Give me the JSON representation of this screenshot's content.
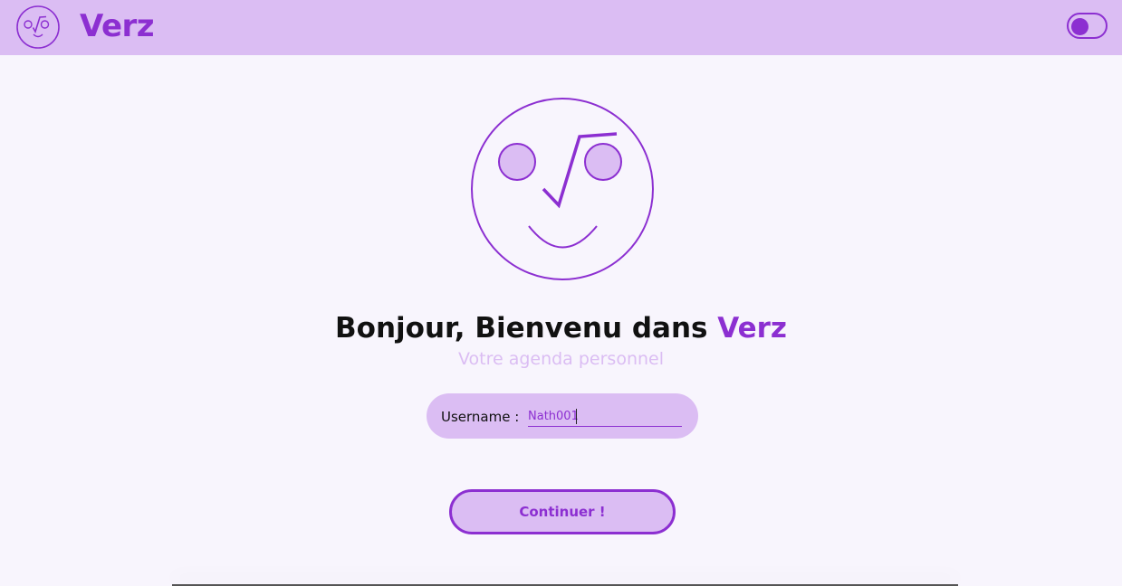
{
  "header": {
    "brand": "Verz",
    "logo_icon": "smiley-sqrt-icon",
    "theme_toggle": {
      "icon": "toggle-switch-icon",
      "state": "off"
    }
  },
  "hero": {
    "logo_icon": "smiley-sqrt-icon",
    "greeting_prefix": "Bonjour, Bienvenu dans ",
    "greeting_accent": "Verz",
    "subtitle": "Votre agenda personnel"
  },
  "form": {
    "username_label": "Username :",
    "username_value": "Nath001",
    "submit_label": "Continuer !"
  },
  "colors": {
    "accent": "#8c2fd1",
    "accent_light": "#dbbdf3",
    "background": "#f8f5fd"
  }
}
